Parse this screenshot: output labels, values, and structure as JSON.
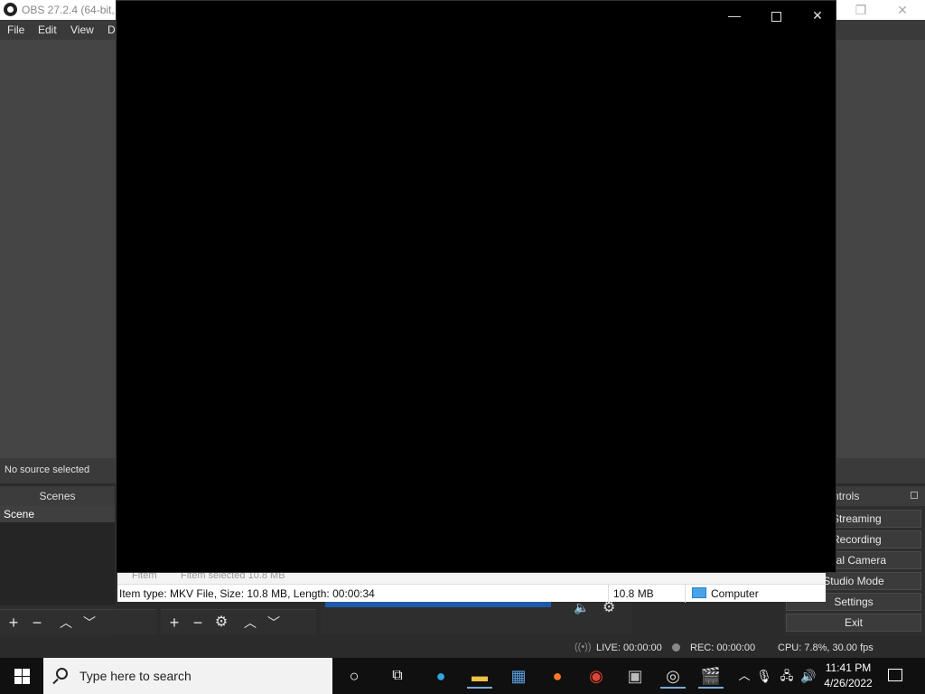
{
  "obs": {
    "title": "OBS 27.2.4 (64-bit, w",
    "menu": [
      "File",
      "Edit",
      "View",
      "D"
    ],
    "source_status": "No source selected",
    "scenes": {
      "title": "Scenes",
      "items": [
        "Scene"
      ]
    },
    "controls": {
      "title": "ntrols",
      "buttons": [
        ": Streaming",
        ": Recording",
        "irtual Camera",
        "Studio Mode",
        "Settings",
        "Exit"
      ]
    },
    "statusbar": {
      "live": "LIVE: 00:00:00",
      "rec": "REC: 00:00:00",
      "cpu": "CPU: 7.8%, 30.00 fps"
    }
  },
  "player": {
    "controls": {
      "minimize": "—",
      "maximize": "",
      "close": "✕"
    }
  },
  "explorer": {
    "strip_left": "Fitem",
    "strip_mid": "Fitem selected  10.8 MB",
    "status_item": "Item type: MKV File, Size: 10.8 MB, Length: 00:00:34",
    "status_size": "10.8 MB",
    "status_location": "Computer"
  },
  "taskbar": {
    "search_placeholder": "Type here to search",
    "time": "11:41 PM",
    "date": "4/26/2022",
    "icons": [
      "cortana-icon",
      "task-view-icon",
      "edge-icon",
      "file-explorer-icon",
      "store-icon",
      "firefox-icon",
      "chrome-icon",
      "photos-icon",
      "obs-icon",
      "clapper-icon"
    ]
  }
}
